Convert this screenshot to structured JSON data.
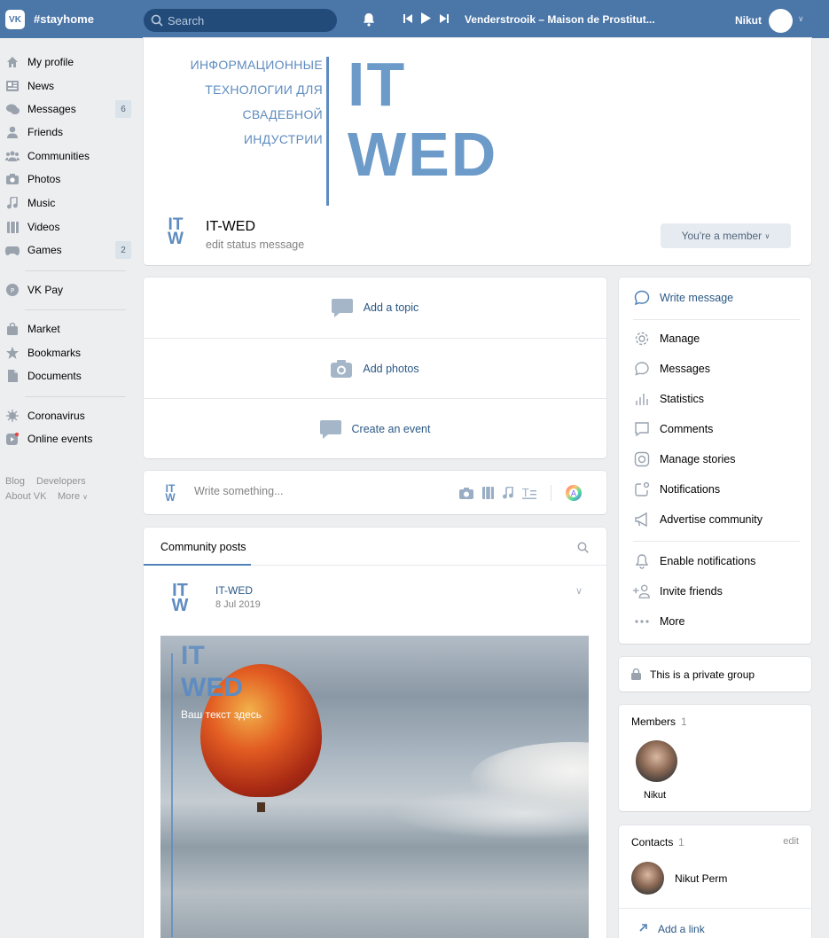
{
  "topbar": {
    "logo": "VK",
    "hashtag": "#stayhome",
    "search_placeholder": "Search",
    "track": "Venderstrooik – Maison de Prostitut...",
    "user_name": "Nikut"
  },
  "nav": {
    "items": [
      {
        "label": "My profile"
      },
      {
        "label": "News"
      },
      {
        "label": "Messages",
        "badge": "6"
      },
      {
        "label": "Friends"
      },
      {
        "label": "Communities"
      },
      {
        "label": "Photos"
      },
      {
        "label": "Music"
      },
      {
        "label": "Videos"
      },
      {
        "label": "Games",
        "badge": "2"
      },
      {
        "label": "VK Pay"
      },
      {
        "label": "Market"
      },
      {
        "label": "Bookmarks"
      },
      {
        "label": "Documents"
      },
      {
        "label": "Coronavirus"
      },
      {
        "label": "Online events"
      }
    ],
    "footer": {
      "blog": "Blog",
      "developers": "Developers",
      "about": "About VK",
      "more": "More"
    }
  },
  "cover": {
    "left_lines": [
      "ИНФОРМАЦИОННЫЕ",
      "ТЕХНОЛОГИИ ДЛЯ",
      "СВАДЕБНОЙ",
      "ИНДУСТРИИ"
    ],
    "big_line1": "IT",
    "big_line2": "WED",
    "logo_top": "IT",
    "logo_bottom": "W"
  },
  "group": {
    "name": "IT-WED",
    "status": "edit status message",
    "member_button": "You're a member"
  },
  "actions": {
    "add_topic": "Add a topic",
    "add_photos": "Add photos",
    "create_event": "Create an event"
  },
  "composer": {
    "placeholder": "Write something..."
  },
  "posts": {
    "tab": "Community posts",
    "author": "IT-WED",
    "date": "8 Jul 2019",
    "image_logo_top": "IT",
    "image_logo_bottom": "WED",
    "image_text": "Ваш текст здесь"
  },
  "right_menu": {
    "write_message": "Write message",
    "manage": "Manage",
    "messages": "Messages",
    "statistics": "Statistics",
    "comments": "Comments",
    "manage_stories": "Manage stories",
    "notifications": "Notifications",
    "advertise": "Advertise community",
    "enable_notifications": "Enable notifications",
    "invite_friends": "Invite friends",
    "more": "More"
  },
  "private": {
    "text": "This is a private group"
  },
  "members": {
    "title": "Members",
    "count": "1",
    "member_name": "Nikut"
  },
  "contacts": {
    "title": "Contacts",
    "count": "1",
    "edit": "edit",
    "contact_name": "Nikut Perm",
    "add_link": "Add a link"
  },
  "colors": {
    "topbar": "#4a76a8",
    "link": "#2a5885",
    "accent": "#5e8cc0"
  }
}
